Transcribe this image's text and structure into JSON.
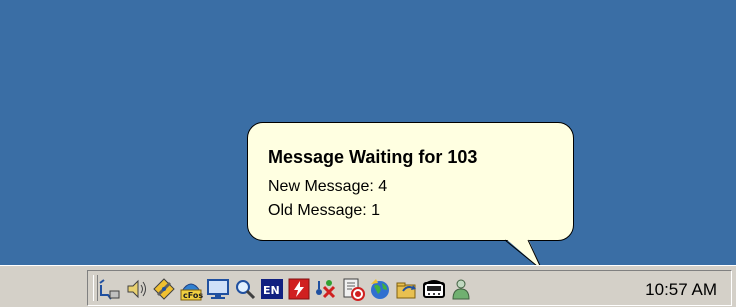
{
  "balloon": {
    "title": "Message Waiting for 103",
    "line1": "New Message: 4",
    "line2": "Old Message: 1"
  },
  "taskbar": {
    "clock": "10:57 AM",
    "tray_icons": [
      "network-cable-icon",
      "volume-icon",
      "pencil-diamond-icon",
      "cfos-icon",
      "display-icon",
      "magnifier-icon",
      "language-en-icon",
      "flash-red-icon",
      "network-tools-icon",
      "record-icon",
      "globe-icon",
      "sync-folder-icon",
      "phone-message-icon",
      "user-profile-icon"
    ],
    "language_label": "EN",
    "cfos_label": "cFos"
  },
  "colors": {
    "desktop": "#3a6ea5",
    "taskbar": "#d4d0c8",
    "balloon": "#ffffe1"
  }
}
